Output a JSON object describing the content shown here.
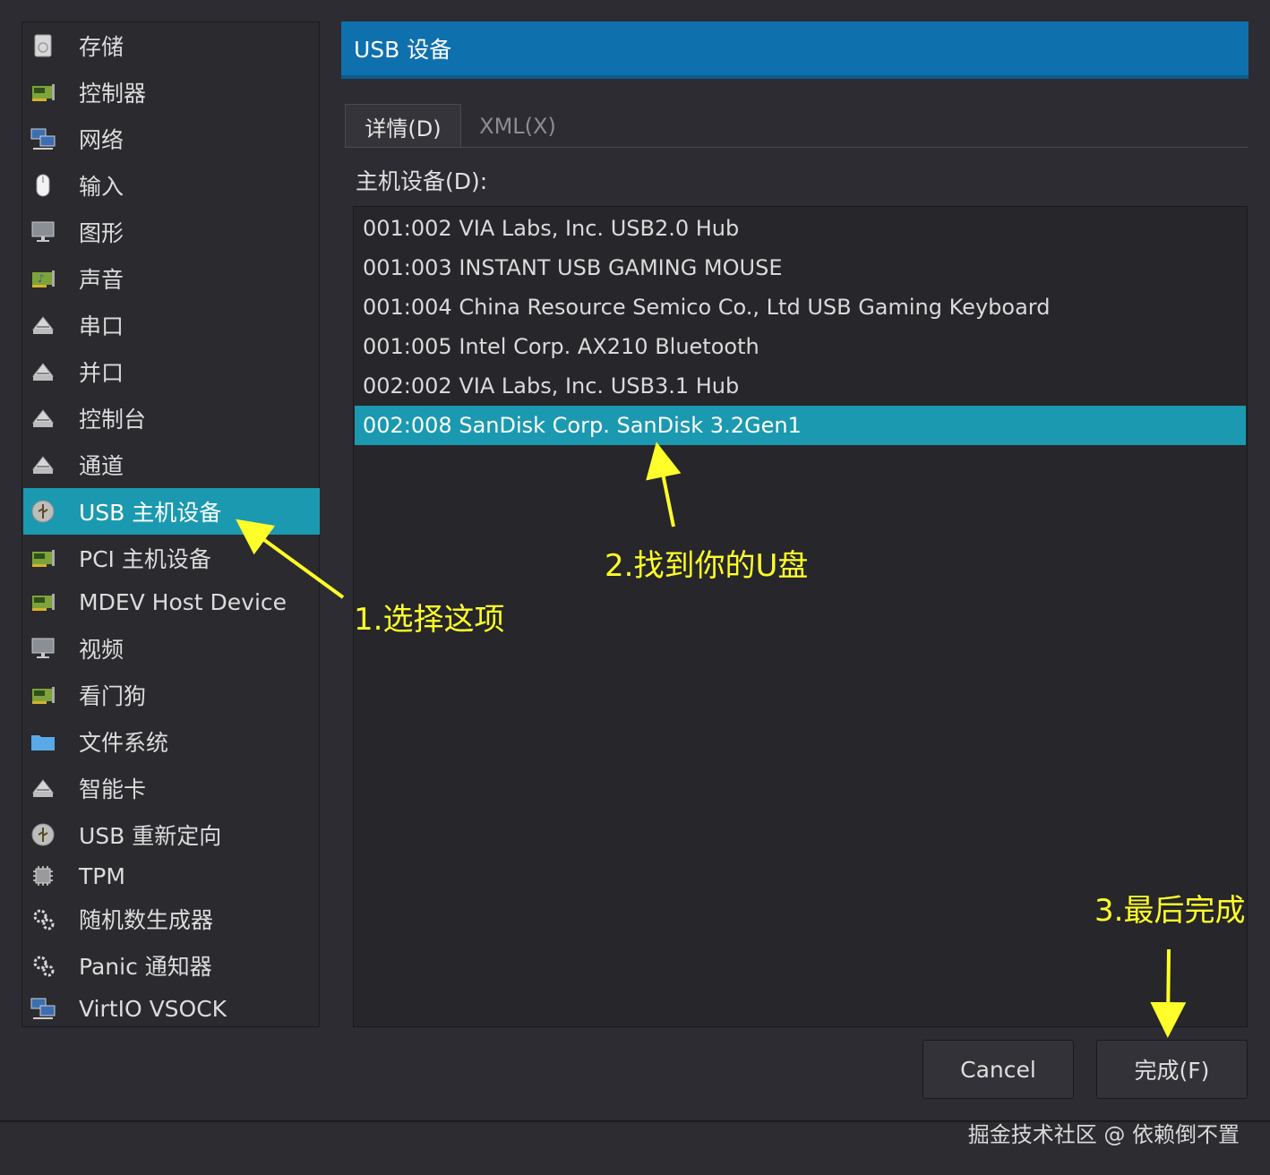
{
  "sidebar": {
    "items": [
      {
        "label": "存储",
        "icon": "storage-icon"
      },
      {
        "label": "控制器",
        "icon": "card-icon"
      },
      {
        "label": "网络",
        "icon": "network-icon"
      },
      {
        "label": "输入",
        "icon": "mouse-icon"
      },
      {
        "label": "图形",
        "icon": "monitor-icon"
      },
      {
        "label": "声音",
        "icon": "sound-card-icon"
      },
      {
        "label": "串口",
        "icon": "serial-icon"
      },
      {
        "label": "并口",
        "icon": "serial-icon"
      },
      {
        "label": "控制台",
        "icon": "serial-icon"
      },
      {
        "label": "通道",
        "icon": "serial-icon"
      },
      {
        "label": "USB 主机设备",
        "icon": "usb-icon",
        "selected": true
      },
      {
        "label": "PCI 主机设备",
        "icon": "card-icon"
      },
      {
        "label": "MDEV Host Device",
        "icon": "card-icon"
      },
      {
        "label": "视频",
        "icon": "monitor-icon"
      },
      {
        "label": "看门狗",
        "icon": "card-icon"
      },
      {
        "label": "文件系统",
        "icon": "folder-icon"
      },
      {
        "label": "智能卡",
        "icon": "serial-icon"
      },
      {
        "label": "USB 重新定向",
        "icon": "usb-icon"
      },
      {
        "label": "TPM",
        "icon": "chip-icon"
      },
      {
        "label": "随机数生成器",
        "icon": "gear-icon"
      },
      {
        "label": "Panic 通知器",
        "icon": "gear-icon"
      },
      {
        "label": "VirtIO VSOCK",
        "icon": "network-icon"
      }
    ]
  },
  "header": {
    "title": "USB 设备"
  },
  "tabs": [
    {
      "label": "详情(D)",
      "active": true
    },
    {
      "label": "XML(X)",
      "active": false
    }
  ],
  "host_device": {
    "label": "主机设备(D):",
    "devices": [
      "001:002 VIA Labs, Inc. USB2.0 Hub",
      "001:003 INSTANT USB GAMING MOUSE",
      "001:004 China Resource Semico Co., Ltd USB Gaming Keyboard",
      "001:005 Intel Corp. AX210 Bluetooth",
      "002:002 VIA Labs, Inc. USB3.1 Hub",
      "002:008 SanDisk Corp. SanDisk 3.2Gen1"
    ],
    "selected_index": 5
  },
  "buttons": {
    "cancel": "Cancel",
    "finish": "完成(F)"
  },
  "annotations": {
    "step1": "1.选择这项",
    "step2": "2.找到你的U盘",
    "step3": "3.最后完成"
  },
  "watermark": "掘金技术社区 @ 依赖倒不置",
  "colors": {
    "selection": "#1b99b0",
    "header": "#0f70ae",
    "annotation": "#ffff2a",
    "background": "#2c2c32"
  }
}
